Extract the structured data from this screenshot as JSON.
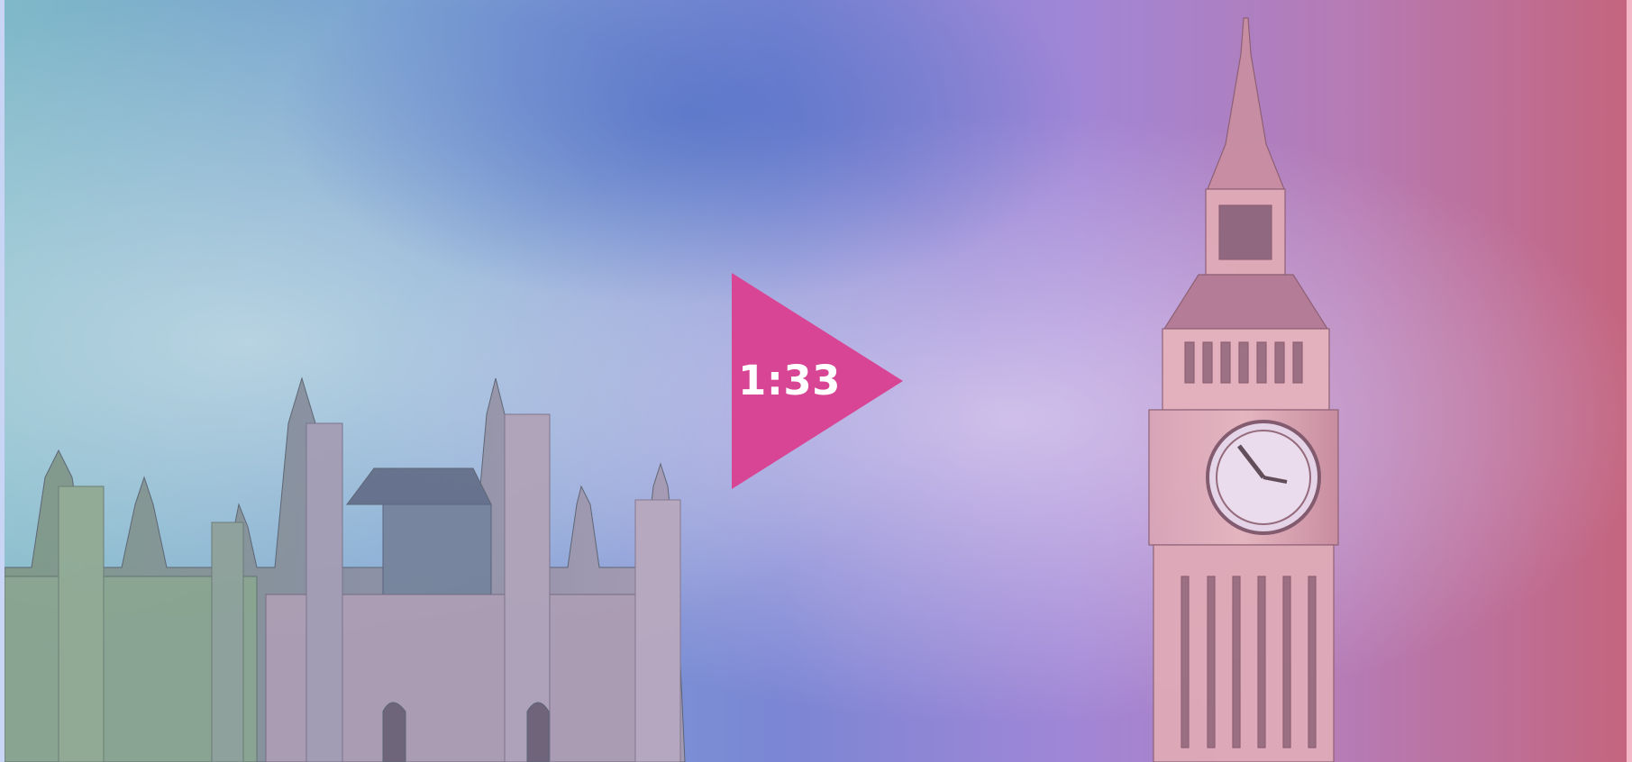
{
  "video": {
    "duration_label": "1:33",
    "play_icon": "play-triangle-icon",
    "colors": {
      "play_accent": "#d94595",
      "overlay_left": "#6fb3b9",
      "overlay_middle": "#8e6fd0",
      "overlay_right": "#c05b78"
    }
  }
}
